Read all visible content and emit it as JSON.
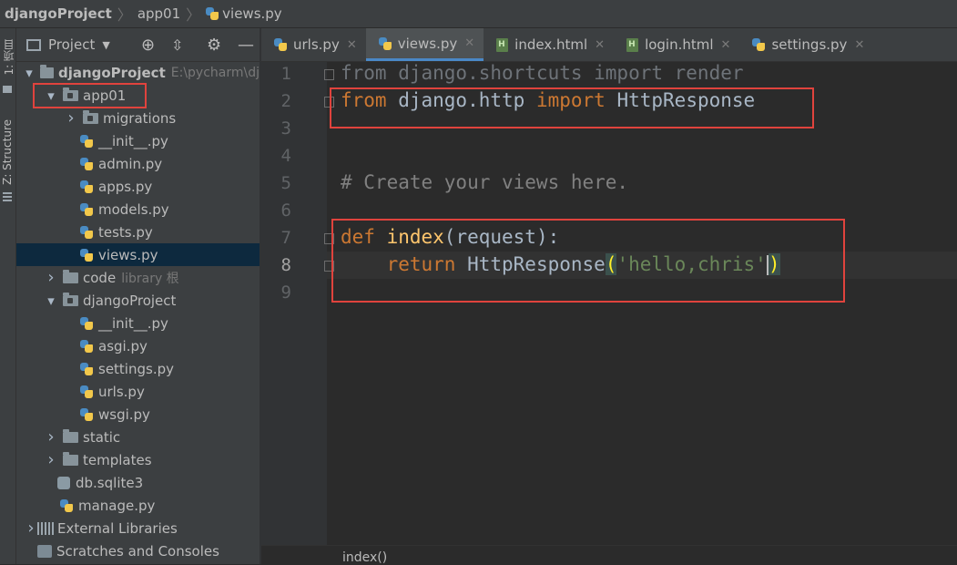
{
  "breadcrumb": [
    "djangoProject",
    "app01",
    "views.py"
  ],
  "left_strip": {
    "project_label": "1: 项目",
    "structure_label": "Z: Structure"
  },
  "project_panel": {
    "title": "Project",
    "tree": [
      {
        "label": "djangoProject",
        "extra": "E:\\pycharm\\dj",
        "depth": 0,
        "expanded": true,
        "icon": "folder-icon",
        "bold": true
      },
      {
        "label": "app01",
        "depth": 1,
        "expanded": true,
        "icon": "package-icon"
      },
      {
        "label": "migrations",
        "depth": 2,
        "expanded": false,
        "icon": "package-icon"
      },
      {
        "label": "__init__.py",
        "depth": 2,
        "icon": "python-file-icon"
      },
      {
        "label": "admin.py",
        "depth": 2,
        "icon": "python-file-icon"
      },
      {
        "label": "apps.py",
        "depth": 2,
        "icon": "python-file-icon"
      },
      {
        "label": "models.py",
        "depth": 2,
        "icon": "python-file-icon"
      },
      {
        "label": "tests.py",
        "depth": 2,
        "icon": "python-file-icon"
      },
      {
        "label": "views.py",
        "depth": 2,
        "icon": "python-file-icon",
        "selected": true
      },
      {
        "label": "code",
        "extra": "library 根",
        "depth": 1,
        "expanded": false,
        "icon": "folder-icon"
      },
      {
        "label": "djangoProject",
        "depth": 1,
        "expanded": true,
        "icon": "package-icon"
      },
      {
        "label": "__init__.py",
        "depth": 2,
        "icon": "python-file-icon"
      },
      {
        "label": "asgi.py",
        "depth": 2,
        "icon": "python-file-icon"
      },
      {
        "label": "settings.py",
        "depth": 2,
        "icon": "python-file-icon"
      },
      {
        "label": "urls.py",
        "depth": 2,
        "icon": "python-file-icon"
      },
      {
        "label": "wsgi.py",
        "depth": 2,
        "icon": "python-file-icon"
      },
      {
        "label": "static",
        "depth": 1,
        "expanded": false,
        "icon": "folder-icon"
      },
      {
        "label": "templates",
        "depth": 1,
        "expanded": false,
        "icon": "folder-icon"
      },
      {
        "label": "db.sqlite3",
        "depth": 1,
        "icon": "database-icon"
      },
      {
        "label": "manage.py",
        "depth": 1,
        "icon": "python-file-icon"
      },
      {
        "label": "External Libraries",
        "depth": 0,
        "expanded": false,
        "icon": "library-icon"
      },
      {
        "label": "Scratches and Consoles",
        "depth": 0,
        "icon": "scratches-icon"
      }
    ]
  },
  "tabs": [
    {
      "label": "urls.py",
      "icon": "python-file-icon",
      "active": false
    },
    {
      "label": "views.py",
      "icon": "python-file-icon",
      "active": true
    },
    {
      "label": "index.html",
      "icon": "html-file-icon",
      "active": false
    },
    {
      "label": "login.html",
      "icon": "html-file-icon",
      "active": false
    },
    {
      "label": "settings.py",
      "icon": "python-file-icon",
      "active": false
    }
  ],
  "editor": {
    "line_numbers": [
      "1",
      "2",
      "3",
      "4",
      "5",
      "6",
      "7",
      "8",
      "9"
    ],
    "current_line": 8,
    "lines": [
      "from django.shortcuts import render",
      "from django.http import HttpResponse",
      "",
      "",
      "# Create your views here.",
      "",
      "def index(request):",
      "    return HttpResponse('hello,chris')",
      ""
    ],
    "tokens": {
      "l1": "from django.shortcuts import render",
      "l2_from": "from",
      "l2_mod": " django.http ",
      "l2_import": "import",
      "l2_name": " HttpResponse",
      "l5": "# Create your views here.",
      "l7_def": "def",
      "l7_fn": " index",
      "l7_rest": "(request):",
      "l8_indent": "    ",
      "l8_return": "return",
      "l8_call": " HttpResponse",
      "l8_lp": "(",
      "l8_str": "'hello,chris'",
      "l8_rp": ")"
    }
  },
  "status": {
    "breadcrumb": "index()"
  },
  "colors": {
    "annotation": "#e0433d",
    "keyword": "#cc7832",
    "function": "#ffc66d",
    "string": "#6a8759",
    "comment": "#808080"
  }
}
